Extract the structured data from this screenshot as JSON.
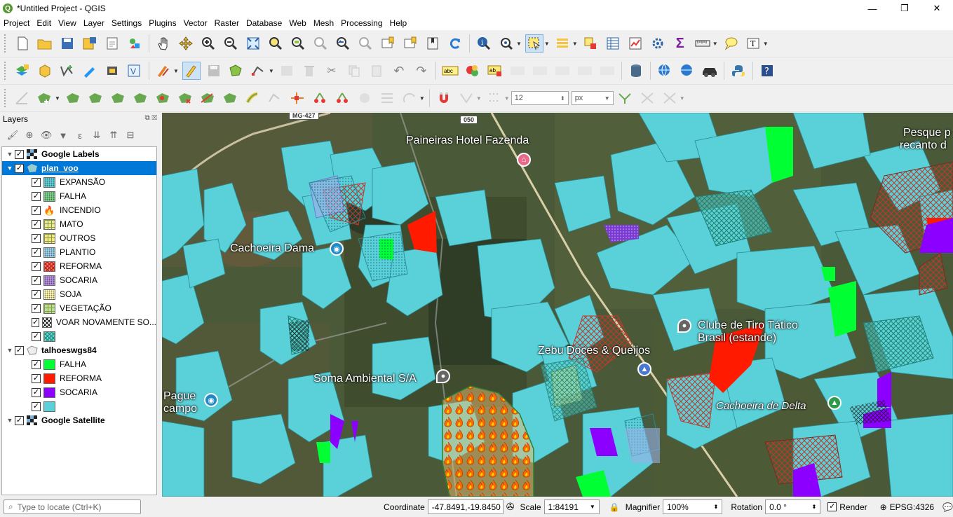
{
  "window": {
    "title": "*Untitled Project - QGIS",
    "minimize": "—",
    "maximize": "❐",
    "close": "✕"
  },
  "menu": [
    "Project",
    "Edit",
    "View",
    "Layer",
    "Settings",
    "Plugins",
    "Vector",
    "Raster",
    "Database",
    "Web",
    "Mesh",
    "Processing",
    "Help"
  ],
  "toolbar3": {
    "snap_tolerance": "12",
    "snap_unit": "px"
  },
  "layers_panel": {
    "title": "Layers",
    "layers": [
      {
        "name": "Google Labels",
        "bold": true
      },
      {
        "name": "plan_voo",
        "bold": true,
        "selected": true,
        "classes": [
          {
            "label": "EXPANSÃO",
            "fill": "#5fd0d8",
            "pattern": "dots"
          },
          {
            "label": "FALHA",
            "fill": "#7bd08a",
            "pattern": "dots"
          },
          {
            "label": "INCENDIO",
            "fill": "#ff8c00",
            "pattern": "fire"
          },
          {
            "label": "MATO",
            "fill": "#e6e8a0",
            "pattern": "grid"
          },
          {
            "label": "OUTROS",
            "fill": "#f3e58a",
            "pattern": "grid"
          },
          {
            "label": "PLANTIO",
            "fill": "#9ccfe8",
            "pattern": "dots"
          },
          {
            "label": "REFORMA",
            "fill": "#ff6a5a",
            "pattern": "cross"
          },
          {
            "label": "SOCARIA",
            "fill": "#b58ee0",
            "pattern": "dots"
          },
          {
            "label": "SOJA",
            "fill": "#fbf3b0",
            "pattern": "dots"
          },
          {
            "label": "VEGETAÇÃO",
            "fill": "#b8e0a0",
            "pattern": "grid"
          },
          {
            "label": "VOAR NOVAMENTE SO...",
            "fill": "#222222",
            "pattern": "cross"
          },
          {
            "label": "",
            "fill": "#5ed6c8",
            "pattern": "cross"
          }
        ]
      },
      {
        "name": "talhoeswgs84",
        "bold": true,
        "classes": [
          {
            "label": "FALHA",
            "fill": "#00ff33"
          },
          {
            "label": "REFORMA",
            "fill": "#ff1a00"
          },
          {
            "label": "SOCARIA",
            "fill": "#8b00ff"
          },
          {
            "label": "",
            "fill": "#5ad0d8"
          }
        ]
      },
      {
        "name": "Google Satellite",
        "bold": true
      }
    ]
  },
  "map": {
    "labels": [
      {
        "text": "Paineiras Hotel Fazenda"
      },
      {
        "text": "Cachoeira Dama"
      },
      {
        "text": "Clube de Tiro Tático"
      },
      {
        "text": "Brasil (estande)"
      },
      {
        "text": "Zebu Doces & Queijos"
      },
      {
        "text": "Soma Ambiental S/A"
      },
      {
        "text": "Pague"
      },
      {
        "text": "campo"
      },
      {
        "text": "Cachoeira de Delta"
      },
      {
        "text": "Pesque p"
      },
      {
        "text": "recanto d"
      }
    ],
    "road_signs": [
      "MG-427",
      "050"
    ]
  },
  "status": {
    "locate_placeholder": "Type to locate (Ctrl+K)",
    "coordinate_label": "Coordinate",
    "coordinate": "-47.8491,-19.8450",
    "scale_label": "Scale",
    "scale": "1:84191",
    "magnifier_label": "Magnifier",
    "magnifier": "100%",
    "rotation_label": "Rotation",
    "rotation": "0.0 °",
    "render_label": "Render",
    "crs": "EPSG:4326"
  }
}
